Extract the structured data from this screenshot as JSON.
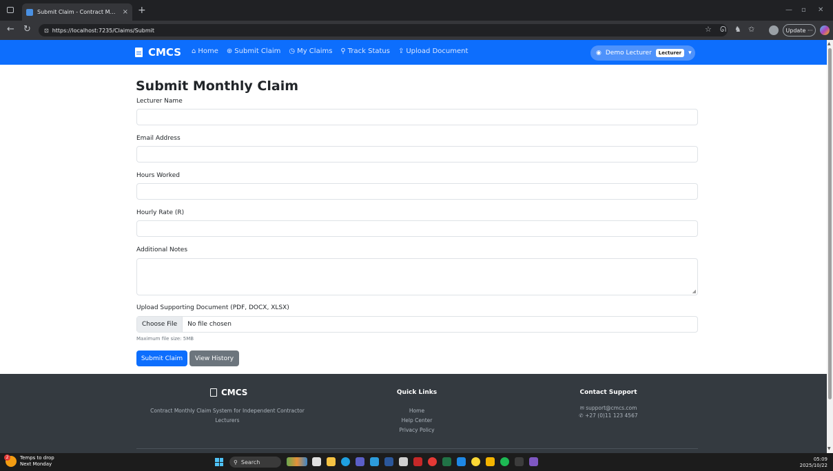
{
  "browser": {
    "tab_title": "Submit Claim - Contract Monthly",
    "tab_close": "×",
    "url": "https://localhost:7235/Claims/Submit",
    "update_label": "Update ···"
  },
  "navbar": {
    "brand": "CMCS",
    "links": [
      {
        "label": "Home",
        "icon": "home-icon",
        "glyph": "⌂"
      },
      {
        "label": "Submit Claim",
        "icon": "plus-circle-icon",
        "glyph": "⊕"
      },
      {
        "label": "My Claims",
        "icon": "clock-icon",
        "glyph": "◷"
      },
      {
        "label": "Track Status",
        "icon": "search-icon",
        "glyph": "⚲"
      },
      {
        "label": "Upload Document",
        "icon": "upload-icon",
        "glyph": "⇪"
      }
    ],
    "user_name": "Demo Lecturer",
    "user_role": "Lecturer"
  },
  "form": {
    "title": "Submit Monthly Claim",
    "fields": {
      "lecturer_name": {
        "label": "Lecturer Name",
        "value": "",
        "placeholder": ""
      },
      "email": {
        "label": "Email Address",
        "value": "",
        "placeholder": ""
      },
      "hours": {
        "label": "Hours Worked",
        "value": "",
        "placeholder": ""
      },
      "rate": {
        "label": "Hourly Rate (R)",
        "value": "",
        "placeholder": ""
      },
      "notes": {
        "label": "Additional Notes",
        "value": ""
      }
    },
    "upload": {
      "label": "Upload Supporting Document (PDF, DOCX, XLSX)",
      "choose_label": "Choose File",
      "status": "No file chosen",
      "hint": "Maximum file size: 5MB"
    },
    "submit_label": "Submit Claim",
    "history_label": "View History"
  },
  "footer": {
    "brand": "CMCS",
    "description": "Contract Monthly Claim System for Independent Contractor Lecturers",
    "quick_links_title": "Quick Links",
    "links": [
      "Home",
      "Help Center",
      "Privacy Policy"
    ],
    "contact_title": "Contact Support",
    "email": "support@cmcs.com",
    "phone": "+27 (0)11 123 4567"
  },
  "taskbar": {
    "weather_badge": "2",
    "weather_line1": "Temps to drop",
    "weather_line2": "Next Monday",
    "search_label": "Search",
    "time": "05:09",
    "date": "2025/10/22"
  },
  "colors": {
    "primary": "#0d6efd",
    "secondary": "#6c757d",
    "footer_bg": "#343a40"
  }
}
